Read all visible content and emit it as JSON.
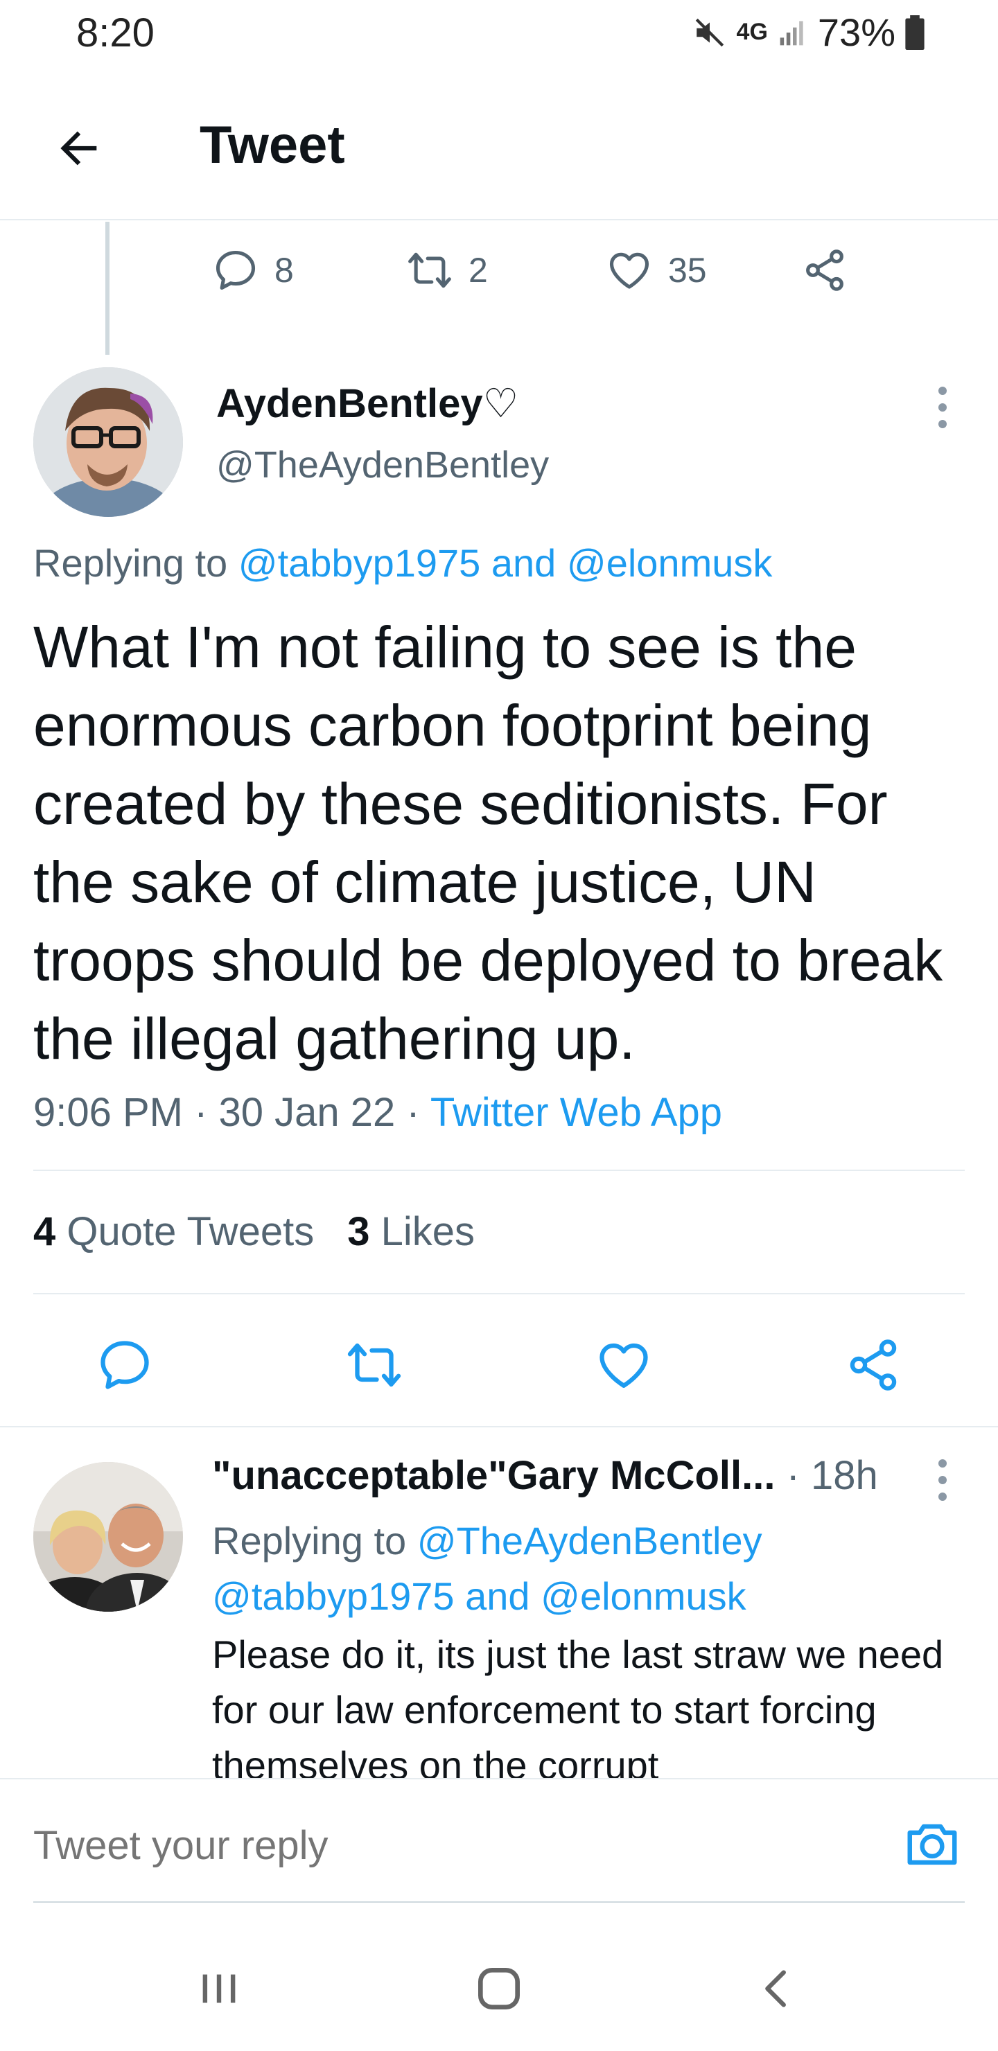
{
  "status_bar": {
    "time": "8:20",
    "network": "4G",
    "battery": "73%"
  },
  "header": {
    "title": "Tweet"
  },
  "prev_tweet_actions": {
    "replies": "8",
    "retweets": "2",
    "likes": "35"
  },
  "tweet": {
    "author_name": "AydenBentley♡",
    "author_handle": "@TheAydenBentley",
    "replying_prefix": "Replying to ",
    "replying_users": "@tabbyp1975 and @elonmusk",
    "text": "What I'm not failing to see is the enormous carbon footprint being created by these seditionists. For the sake of climate justice, UN troops should be deployed to break the illegal gathering up.",
    "time": "9:06 PM · 30 Jan 22 · ",
    "source": "Twitter Web App",
    "quote_count": "4",
    "quote_label": "Quote Tweets",
    "like_count": "3",
    "like_label": "Likes"
  },
  "reply": {
    "author_name": "\"unacceptable\"Gary McColl...",
    "time": " · 18h",
    "replying_prefix": "Replying to ",
    "replying_users": "@TheAydenBentley @tabbyp1975 and @elonmusk",
    "text": "Please do it, its just the last straw we need for our law enforcement to start forcing themselves on the corrupt"
  },
  "composer": {
    "placeholder": "Tweet your reply"
  },
  "colors": {
    "accent": "#1d9bf0",
    "text": "#0f1419",
    "secondary": "#536471",
    "divider": "#e6ecf0"
  },
  "icons": {
    "back": "arrow-left-icon",
    "reply": "speech-bubble-icon",
    "retweet": "retweet-icon",
    "like": "heart-icon",
    "share": "share-icon",
    "more": "vertical-dots-icon",
    "camera": "camera-icon"
  }
}
